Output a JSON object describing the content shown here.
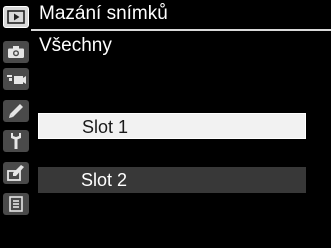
{
  "header": {
    "title": "Mazání snímků"
  },
  "screen": {
    "subtitle": "Všechny"
  },
  "menu": {
    "items": [
      {
        "label": "Slot 1",
        "selected": true
      },
      {
        "label": "Slot 2",
        "selected": false
      }
    ]
  },
  "sidebar": {
    "items": [
      {
        "icon": "playback-icon",
        "active": true
      },
      {
        "icon": "camera-icon",
        "active": false
      },
      {
        "icon": "movie-camera-icon",
        "active": false
      },
      {
        "icon": "pencil-icon",
        "active": false
      },
      {
        "icon": "wrench-icon",
        "active": false
      },
      {
        "icon": "retouch-icon",
        "active": false
      },
      {
        "icon": "my-menu-icon",
        "active": false
      }
    ]
  },
  "colors": {
    "background": "#000000",
    "selected_bg": "#f2f2f2",
    "item_bg": "#383838",
    "divider": "#d9d9d9",
    "icon_bg": "#4a4a4a"
  }
}
